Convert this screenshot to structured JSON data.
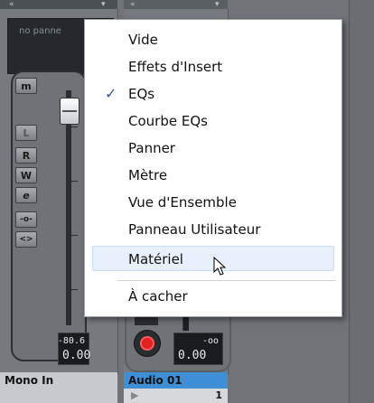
{
  "strip_left": {
    "name_text": "no panne",
    "buttons": [
      "m",
      "L",
      "R",
      "W",
      "e",
      "-o-",
      "<>"
    ],
    "readout_small": "-80.6",
    "readout_big": "0.00",
    "label": "Mono In"
  },
  "strip_right": {
    "readout_small": "-oo",
    "readout_big": "0.00",
    "label": "Audio 01",
    "track_number": "1"
  },
  "context_menu": {
    "items": [
      {
        "label": "Vide",
        "checked": false
      },
      {
        "label": "Effets d'Insert",
        "checked": false
      },
      {
        "label": "EQs",
        "checked": true
      },
      {
        "label": "Courbe EQs",
        "checked": false
      },
      {
        "label": "Panner",
        "checked": false
      },
      {
        "label": "Mètre",
        "checked": false
      },
      {
        "label": "Vue d'Ensemble",
        "checked": false
      },
      {
        "label": "Panneau Utilisateur",
        "checked": false
      },
      {
        "label": "Matériel",
        "checked": false,
        "hovered": true
      },
      {
        "label": "À cacher",
        "checked": false
      }
    ],
    "check_glyph": "✓"
  },
  "colors": {
    "menu_hover": "#e8f1fb",
    "check": "#2c5ca8",
    "label_selected_bg": "#3f8fd6",
    "record": "#e02222"
  }
}
